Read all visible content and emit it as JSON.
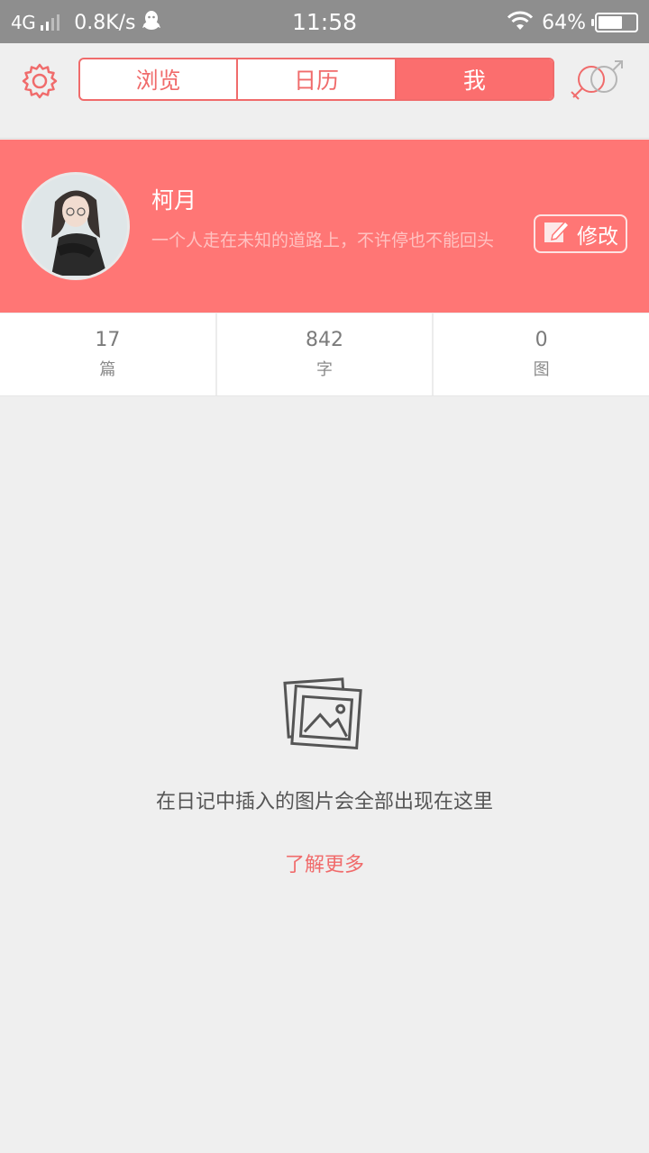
{
  "status_bar": {
    "network": "4G",
    "speed": "0.8K/s",
    "time": "11:58",
    "battery": "64%",
    "battery_level": 0.64
  },
  "header": {
    "tabs": [
      {
        "label": "浏览",
        "active": false
      },
      {
        "label": "日历",
        "active": false
      },
      {
        "label": "我",
        "active": true
      }
    ]
  },
  "profile": {
    "name": "柯月",
    "bio": "一个人走在未知的道路上，不许停也不能回头",
    "edit_label": "修改"
  },
  "stats": [
    {
      "value": "17",
      "label": "篇"
    },
    {
      "value": "842",
      "label": "字"
    },
    {
      "value": "0",
      "label": "图"
    }
  ],
  "empty_state": {
    "message": "在日记中插入的图片会全部出现在这里",
    "link": "了解更多"
  },
  "colors": {
    "accent": "#ff7675",
    "status_bar": "#8e8e8e",
    "background": "#efefef"
  },
  "icons": [
    "qq-icon",
    "wifi-icon",
    "battery-icon",
    "gear-icon",
    "gender-icon",
    "edit-icon",
    "photos-icon"
  ]
}
